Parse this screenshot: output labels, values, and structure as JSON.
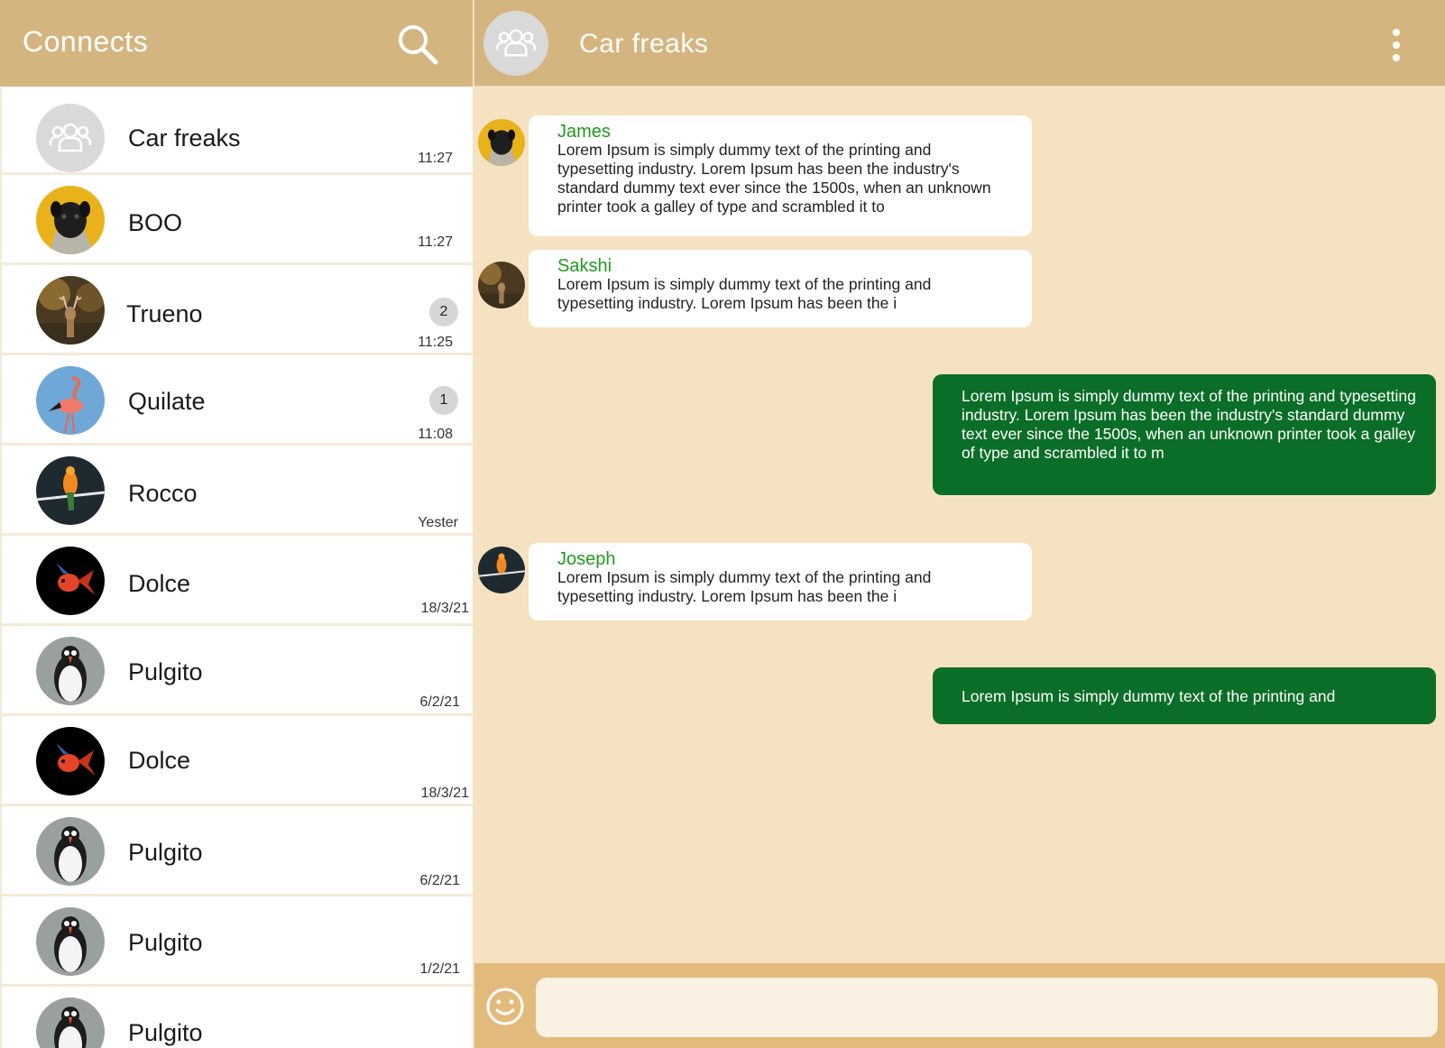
{
  "left_header": {
    "title": "Connects",
    "search_icon": "search-icon"
  },
  "chats": [
    {
      "name": "Car freaks",
      "time": "11:27",
      "badge": "",
      "avatar": "group-icon"
    },
    {
      "name": "BOO",
      "time": "11:27",
      "badge": "",
      "avatar": "pug-dog-photo"
    },
    {
      "name": "Trueno",
      "time": "11:25",
      "badge": "2",
      "avatar": "deer-photo"
    },
    {
      "name": "Quilate",
      "time": "11:08",
      "badge": "1",
      "avatar": "flamingo-photo"
    },
    {
      "name": "Rocco",
      "time": "Yester",
      "badge": "",
      "avatar": "parrot-photo"
    },
    {
      "name": "Dolce",
      "time": "18/3/21",
      "badge": "",
      "avatar": "goldfish-photo"
    },
    {
      "name": "Pulgito",
      "time": "6/2/21",
      "badge": "",
      "avatar": "puffin-photo"
    },
    {
      "name": "Dolce",
      "time": "18/3/21",
      "badge": "",
      "avatar": "goldfish-photo"
    },
    {
      "name": "Pulgito",
      "time": "6/2/21",
      "badge": "",
      "avatar": "puffin-photo"
    },
    {
      "name": "Pulgito",
      "time": "1/2/21",
      "badge": "",
      "avatar": "puffin-photo"
    },
    {
      "name": "Pulgito",
      "time": "",
      "badge": "",
      "avatar": "puffin-photo"
    }
  ],
  "conversation": {
    "title": "Car freaks",
    "menu_icon": "more-vert-icon",
    "messages": [
      {
        "direction": "in",
        "sender": "James",
        "avatar": "pug-dog-photo",
        "text": "Lorem Ipsum is simply dummy text of the printing and typesetting industry. Lorem Ipsum has been the industry's standard dummy text ever since the 1500s, when an unknown printer took a galley of type and scrambled it to"
      },
      {
        "direction": "in",
        "sender": "Sakshi",
        "avatar": "deer-photo",
        "text": "Lorem Ipsum is simply dummy text of the printing and typesetting industry. Lorem Ipsum has been the i"
      },
      {
        "direction": "out",
        "text": "Lorem Ipsum is simply dummy text of the printing and typesetting industry. Lorem Ipsum has been the industry's standard dummy text ever since the 1500s, when an unknown printer took a galley of type and scrambled it to m"
      },
      {
        "direction": "in",
        "sender": "Joseph",
        "avatar": "parrot-photo",
        "text": "Lorem Ipsum is simply dummy text of the printing and typesetting industry. Lorem Ipsum has been the i"
      },
      {
        "direction": "out",
        "text": "Lorem Ipsum is simply dummy text of the printing and"
      }
    ]
  },
  "composer": {
    "emoji_icon": "emoji-smile-icon",
    "input_value": "",
    "input_placeholder": ""
  },
  "colors": {
    "header": "#d5b57f",
    "chat_bg": "#f5e2c0",
    "outgoing_bubble": "#0b6e28",
    "sender_name": "#1f9a1f",
    "composer_bar": "#e2bb7c"
  }
}
